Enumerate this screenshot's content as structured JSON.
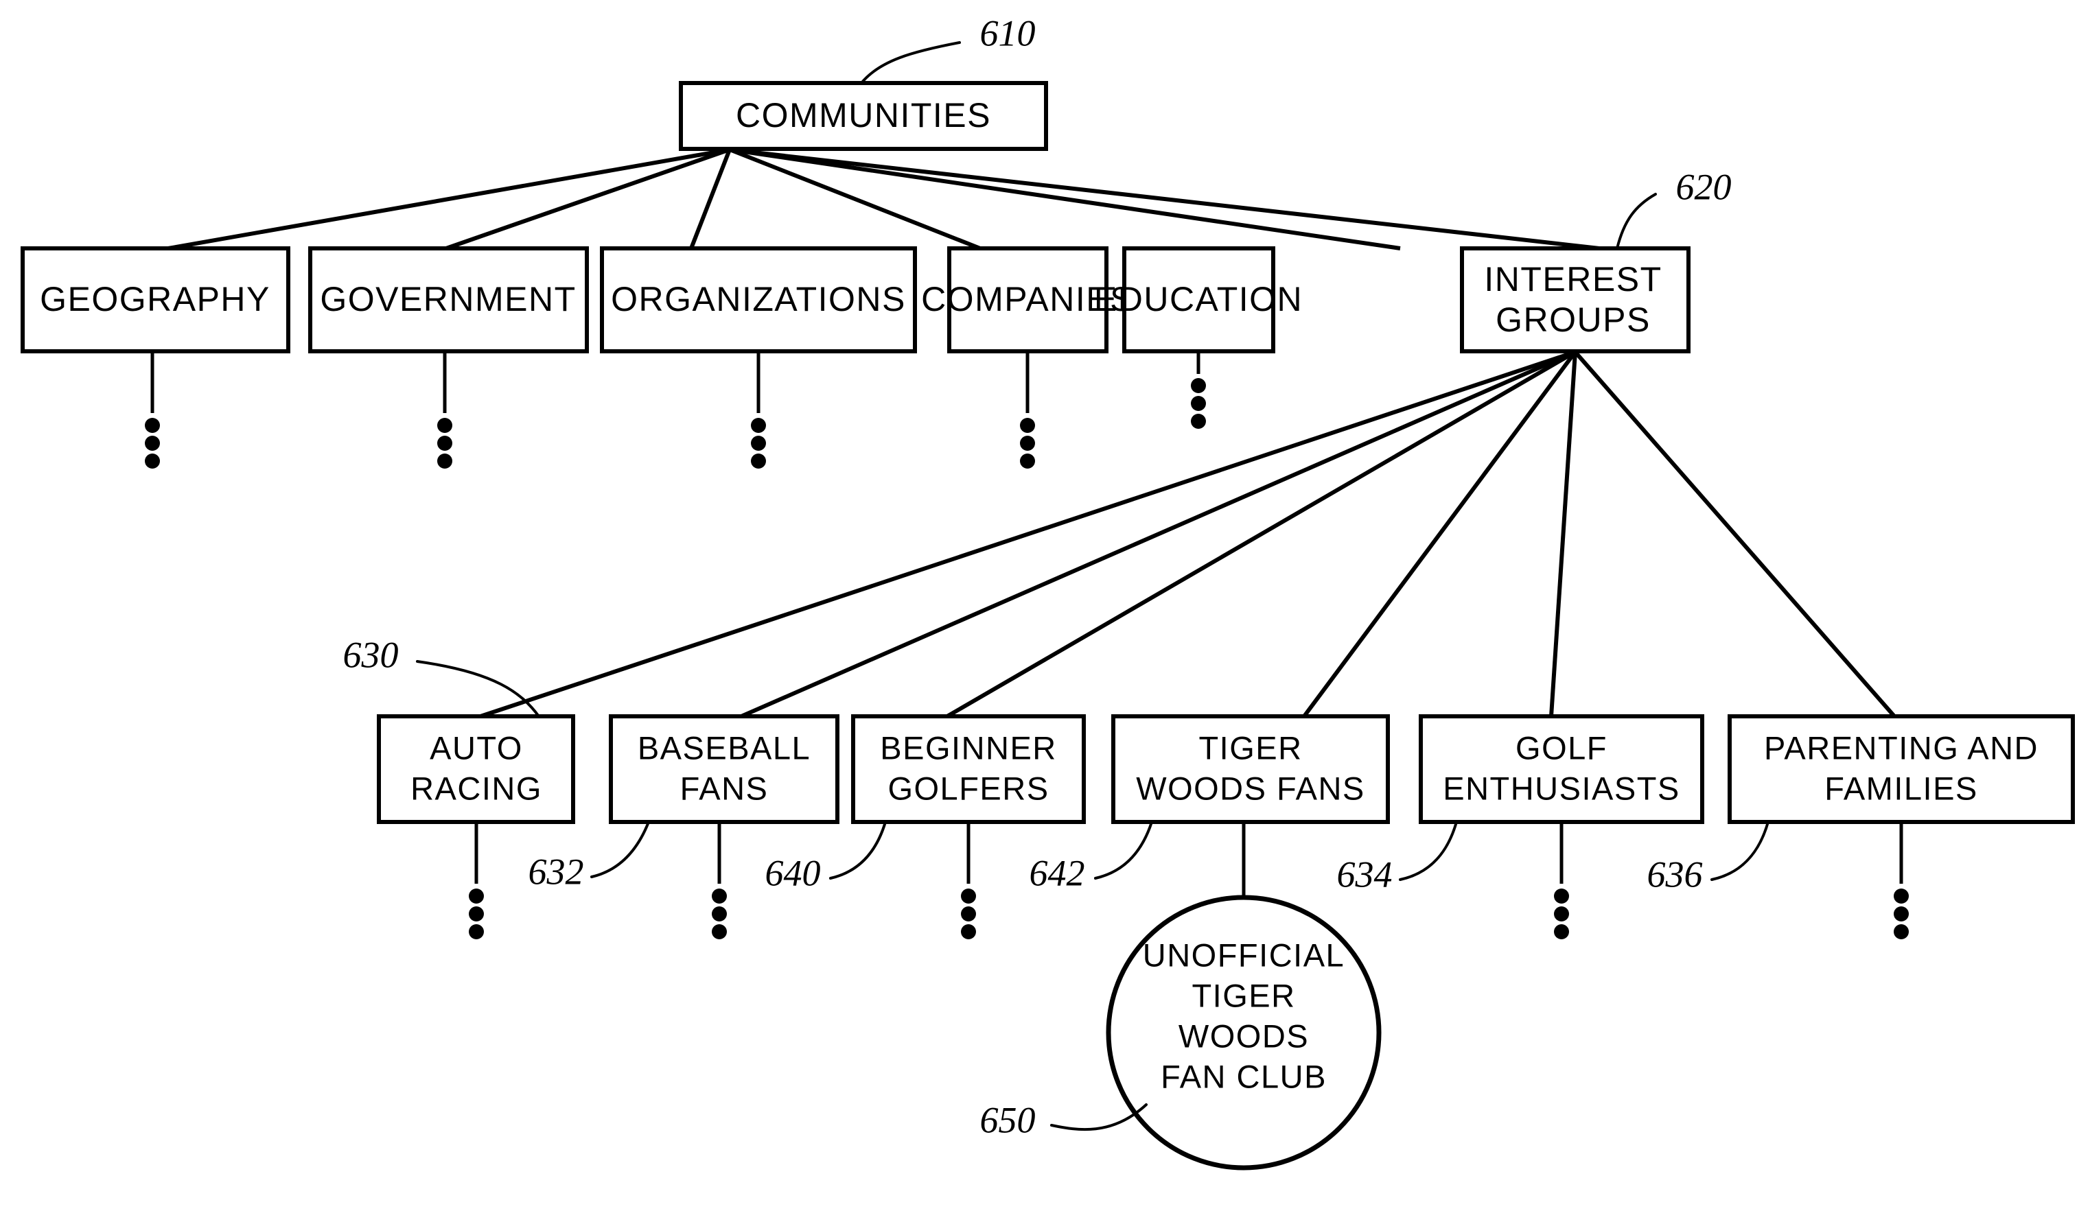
{
  "diagram": {
    "title_figure": "",
    "background_color": "#ffffff",
    "line_color": "#000000",
    "nodes": {
      "root": {
        "label": "COMMUNITIES",
        "ref": "610"
      },
      "level2": [
        {
          "id": "geography",
          "label": "GEOGRAPHY",
          "ref": ""
        },
        {
          "id": "government",
          "label": "GOVERNMENT",
          "ref": ""
        },
        {
          "id": "organizations",
          "label": "ORGANIZATIONS",
          "ref": ""
        },
        {
          "id": "companies",
          "label": "COMPANIES",
          "ref": ""
        },
        {
          "id": "education",
          "label": "EDUCATION",
          "ref": ""
        },
        {
          "id": "interest",
          "label_line1": "INTEREST",
          "label_line2": "GROUPS",
          "ref": "620"
        }
      ],
      "level3": [
        {
          "id": "auto-racing",
          "label_line1": "AUTO",
          "label_line2": "RACING",
          "ref": "630"
        },
        {
          "id": "baseball-fans",
          "label_line1": "BASEBALL",
          "label_line2": "FANS",
          "ref": "632"
        },
        {
          "id": "beginner-golfers",
          "label_line1": "BEGINNER",
          "label_line2": "GOLFERS",
          "ref": "640"
        },
        {
          "id": "tiger-woods-fans",
          "label_line1": "TIGER",
          "label_line2": "WOODS  FANS",
          "ref": "642"
        },
        {
          "id": "golf-enthusiasts",
          "label_line1": "GOLF",
          "label_line2": "ENTHUSIASTS",
          "ref": "634"
        },
        {
          "id": "parenting-and-families",
          "label_line1": "PARENTING  AND",
          "label_line2": "FAMILIES",
          "ref": "636"
        }
      ],
      "level4": {
        "id": "unofficial-tiger-woods-fan-club",
        "label_line1": "UNOFFICIAL",
        "label_line2": "TIGER",
        "label_line3": "WOODS",
        "label_line4": "FAN  CLUB",
        "ref": "650"
      }
    },
    "reference_numerals": [
      "610",
      "620",
      "630",
      "632",
      "634",
      "636",
      "640",
      "642",
      "650"
    ]
  }
}
